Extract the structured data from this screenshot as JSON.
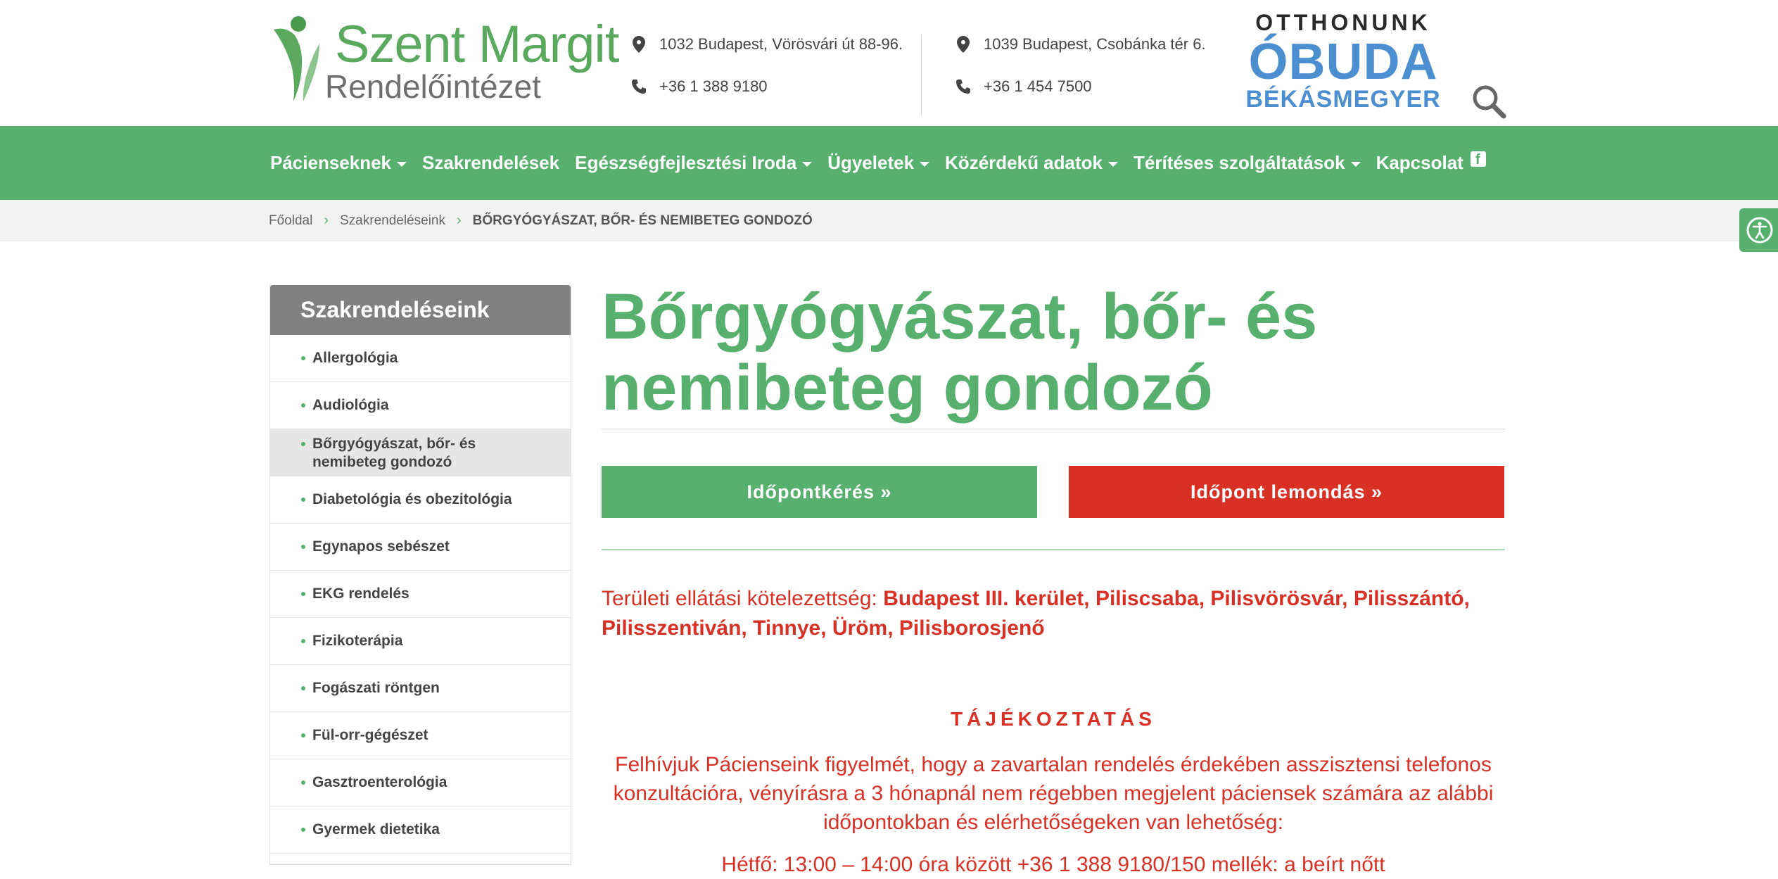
{
  "logo": {
    "line1": "Szent Margit",
    "line2": "Rendelőintézet"
  },
  "contacts": {
    "address1": "1032 Budapest, Vörösvári út 88-96.",
    "phone1": "+36 1 388 9180",
    "address2": "1039 Budapest, Csobánka tér 6.",
    "phone2": "+36 1 454 7500"
  },
  "partner_logo": {
    "line1": "OTTHONUNK",
    "line2": "ÓBUDA",
    "line3": "BÉKÁSMEGYER"
  },
  "nav": {
    "items": [
      {
        "label": "Pácienseknek",
        "dropdown": true
      },
      {
        "label": "Szakrendelések",
        "dropdown": false
      },
      {
        "label": "Egészségfejlesztési Iroda",
        "dropdown": true
      },
      {
        "label": "Ügyeletek",
        "dropdown": true
      },
      {
        "label": "Közérdekű adatok",
        "dropdown": true
      },
      {
        "label": "Térítéses szolgáltatások",
        "dropdown": true
      },
      {
        "label": "Kapcsolat",
        "dropdown": false
      }
    ],
    "facebook_icon": "facebook-icon"
  },
  "breadcrumb": {
    "home": "Főoldal",
    "parent": "Szakrendeléseink",
    "current": "BŐRGYÓGYÁSZAT, BŐR- ÉS NEMIBETEG GONDOZÓ"
  },
  "sidebar": {
    "title": "Szakrendeléseink",
    "items": [
      "Allergológia",
      "Audiológia",
      "Bőrgyógyászat, bőr- és nemibeteg gondozó",
      "Diabetológia és obezitológia",
      "Egynapos sebészet",
      "EKG rendelés",
      "Fizikoterápia",
      "Fogászati röntgen",
      "Fül-orr-gégészet",
      "Gasztroenterológia",
      "Gyermek dietetika"
    ],
    "active_index": 2
  },
  "main": {
    "title": "Bőrgyógyászat, bőr- és nemibeteg gondozó",
    "book_button": "Időpontkérés »",
    "cancel_button": "Időpont lemondás »",
    "area_label": "Területi ellátási kötelezettség:",
    "area_value": "Budapest III. kerület, Piliscsaba, Pilisvörösvár, Pilisszántó, Pilisszentiván, Tinnye, Üröm, Pilisborosjenő",
    "info_title": "TÁJÉKOZTATÁS",
    "info_text": "Felhívjuk Pácienseink figyelmét, hogy a zavartalan rendelés érdekében asszisztensi telefonos konzultációra, vényírásra a 3 hónapnál nem régebben megjelent páciensek számára az alábbi időpontokban és elérhetőségeken van lehetőség:",
    "info_cut": "Hétfő: 13:00 – 14:00 óra között +36 1 388 9180/150 mellék: a beírt nőtt"
  },
  "colors": {
    "brand_green": "#57b06d",
    "alert_red": "#d93025",
    "sidebar_header": "#808080"
  }
}
